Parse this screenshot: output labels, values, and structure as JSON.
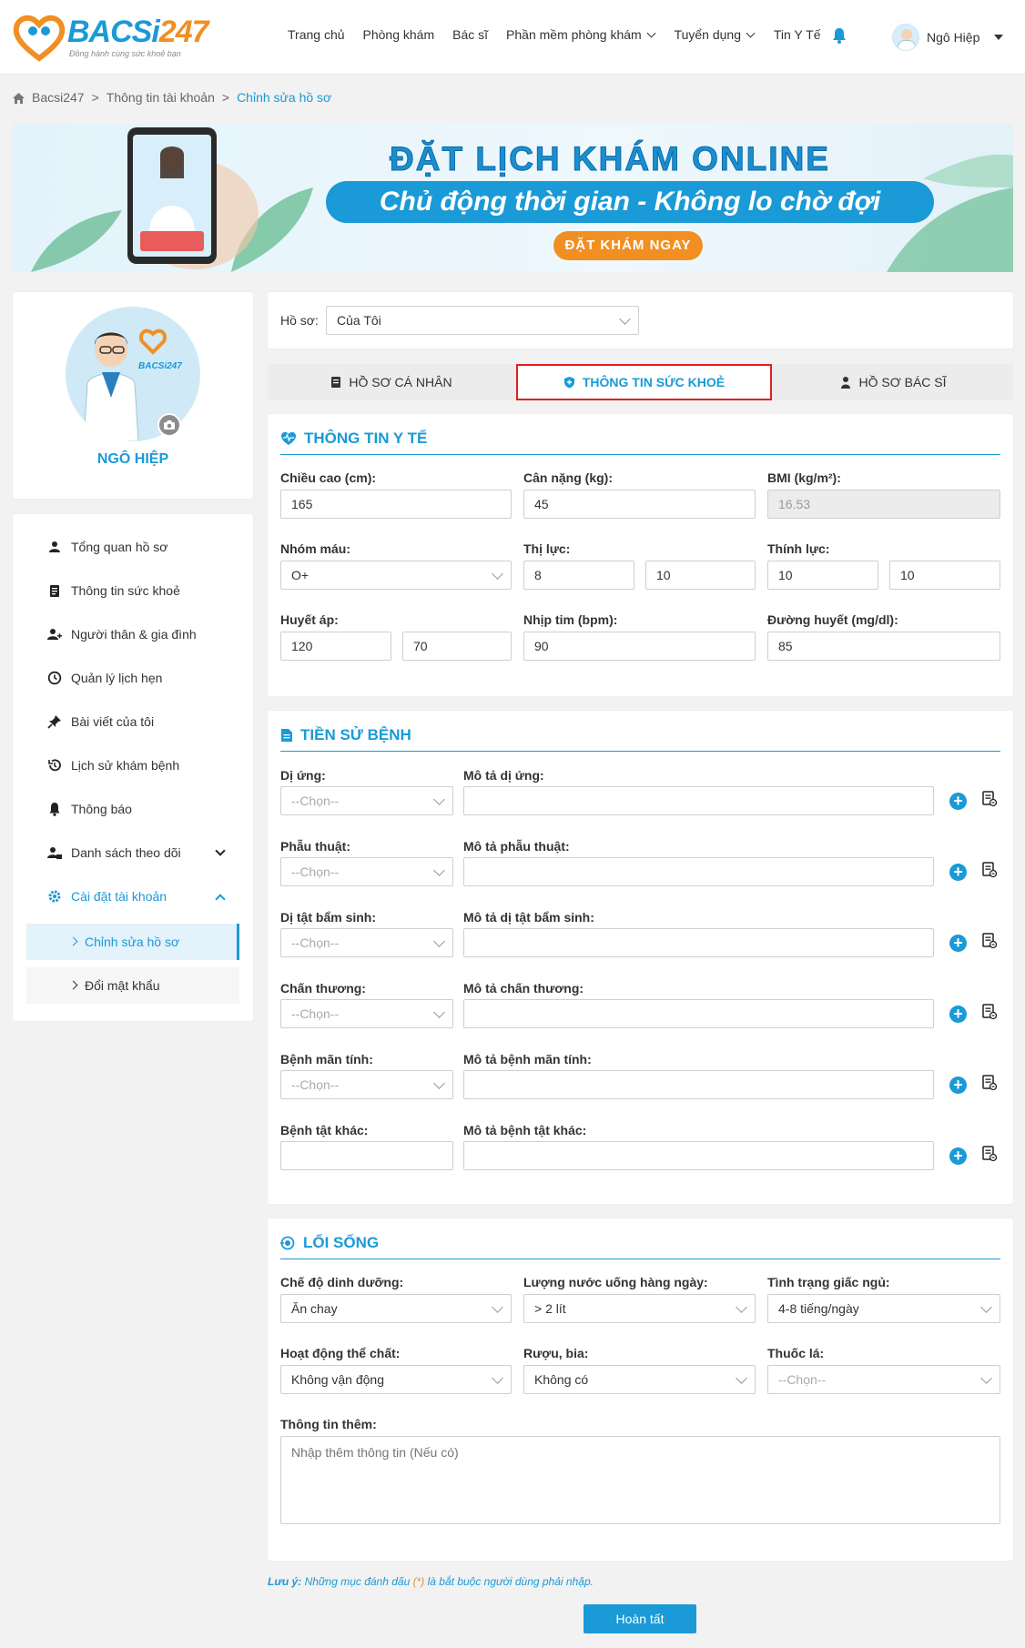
{
  "header": {
    "logo_text_a": "BACSi",
    "logo_text_b": "247",
    "logo_tagline": "Đồng hành cùng sức khoẻ bạn",
    "nav": [
      "Trang chủ",
      "Phòng khám",
      "Bác sĩ",
      "Phần mềm phòng khám",
      "Tuyển dụng",
      "Tin Y Tế"
    ],
    "user_name": "Ngô Hiệp"
  },
  "breadcrumb": [
    "Bacsi247",
    "Thông tin tài khoản",
    "Chỉnh sửa hồ sơ"
  ],
  "banner": {
    "title": "ĐẶT LỊCH KHÁM ONLINE",
    "subtitle": "Chủ động thời gian - Không lo chờ đợi",
    "cta": "ĐẶT KHÁM NGAY"
  },
  "profile": {
    "name": "NGÔ HIỆP"
  },
  "sidebar": {
    "items": [
      "Tổng quan hồ sơ",
      "Thông tin sức khoẻ",
      "Người thân & gia đình",
      "Quản lý lịch hẹn",
      "Bài viết của tôi",
      "Lịch sử khám bệnh",
      "Thông báo",
      "Danh sách theo dõi",
      "Cài đặt tài khoản"
    ],
    "sub_items": [
      "Chỉnh sửa hồ sơ",
      "Đổi mật khẩu"
    ]
  },
  "profile_select": {
    "label": "Hồ sơ:",
    "value": "Của Tôi"
  },
  "tabs": [
    "HỒ SƠ CÁ NHÂN",
    "THÔNG TIN SỨC KHOẺ",
    "HỒ SƠ BÁC SĨ"
  ],
  "medical": {
    "title": "THÔNG TIN Y TẾ",
    "height_label": "Chiều cao (cm):",
    "height": "165",
    "weight_label": "Cân nặng (kg):",
    "weight": "45",
    "bmi_label": "BMI (kg/m²):",
    "bmi": "16.53",
    "blood_label": "Nhóm máu:",
    "blood": "O+",
    "vision_label": "Thị lực:",
    "vision_l": "8",
    "vision_r": "10",
    "hearing_label": "Thính lực:",
    "hearing_l": "10",
    "hearing_r": "10",
    "bp_label": "Huyết áp:",
    "bp_sys": "120",
    "bp_dia": "70",
    "hr_label": "Nhịp tim (bpm):",
    "hr": "90",
    "glucose_label": "Đường huyết (mg/dl):",
    "glucose": "85"
  },
  "history": {
    "title": "TIỀN SỬ BỆNH",
    "placeholder": "--Chọn--",
    "rows": [
      {
        "label": "Dị ứng:",
        "desc": "Mô tả dị ứng:"
      },
      {
        "label": "Phẫu thuật:",
        "desc": "Mô tả phẫu thuật:"
      },
      {
        "label": "Dị tật bẩm sinh:",
        "desc": "Mô tả dị tật bẩm sinh:"
      },
      {
        "label": "Chấn thương:",
        "desc": "Mô tả chấn thương:"
      },
      {
        "label": "Bệnh mãn tính:",
        "desc": "Mô tả bệnh mãn tính:"
      },
      {
        "label": "Bệnh tật khác:",
        "desc": "Mô tả bệnh tật khác:"
      }
    ]
  },
  "lifestyle": {
    "title": "LỐI SỐNG",
    "diet_label": "Chế độ dinh dưỡng:",
    "diet": "Ăn chay",
    "water_label": "Lượng nước uống hàng ngày:",
    "water": "> 2 lít",
    "sleep_label": "Tình trạng giấc ngủ:",
    "sleep": "4-8 tiếng/ngày",
    "activity_label": "Hoạt động thể chất:",
    "activity": "Không vận động",
    "alcohol_label": "Rượu, bia:",
    "alcohol": "Không có",
    "smoking_label": "Thuốc lá:",
    "smoking": "--Chọn--",
    "extra_label": "Thông tin thêm:",
    "extra_placeholder": "Nhập thêm thông tin (Nếu có)"
  },
  "note": {
    "prefix": "Lưu ý:",
    "text_a": "Những mục đánh dấu",
    "star": "(*)",
    "text_b": "là bắt buộc người dùng phải nhập."
  },
  "submit": "Hoàn tất",
  "colors": {
    "primary": "#1a9ad6",
    "accent": "#f18f22",
    "highlight": "#e02020"
  }
}
